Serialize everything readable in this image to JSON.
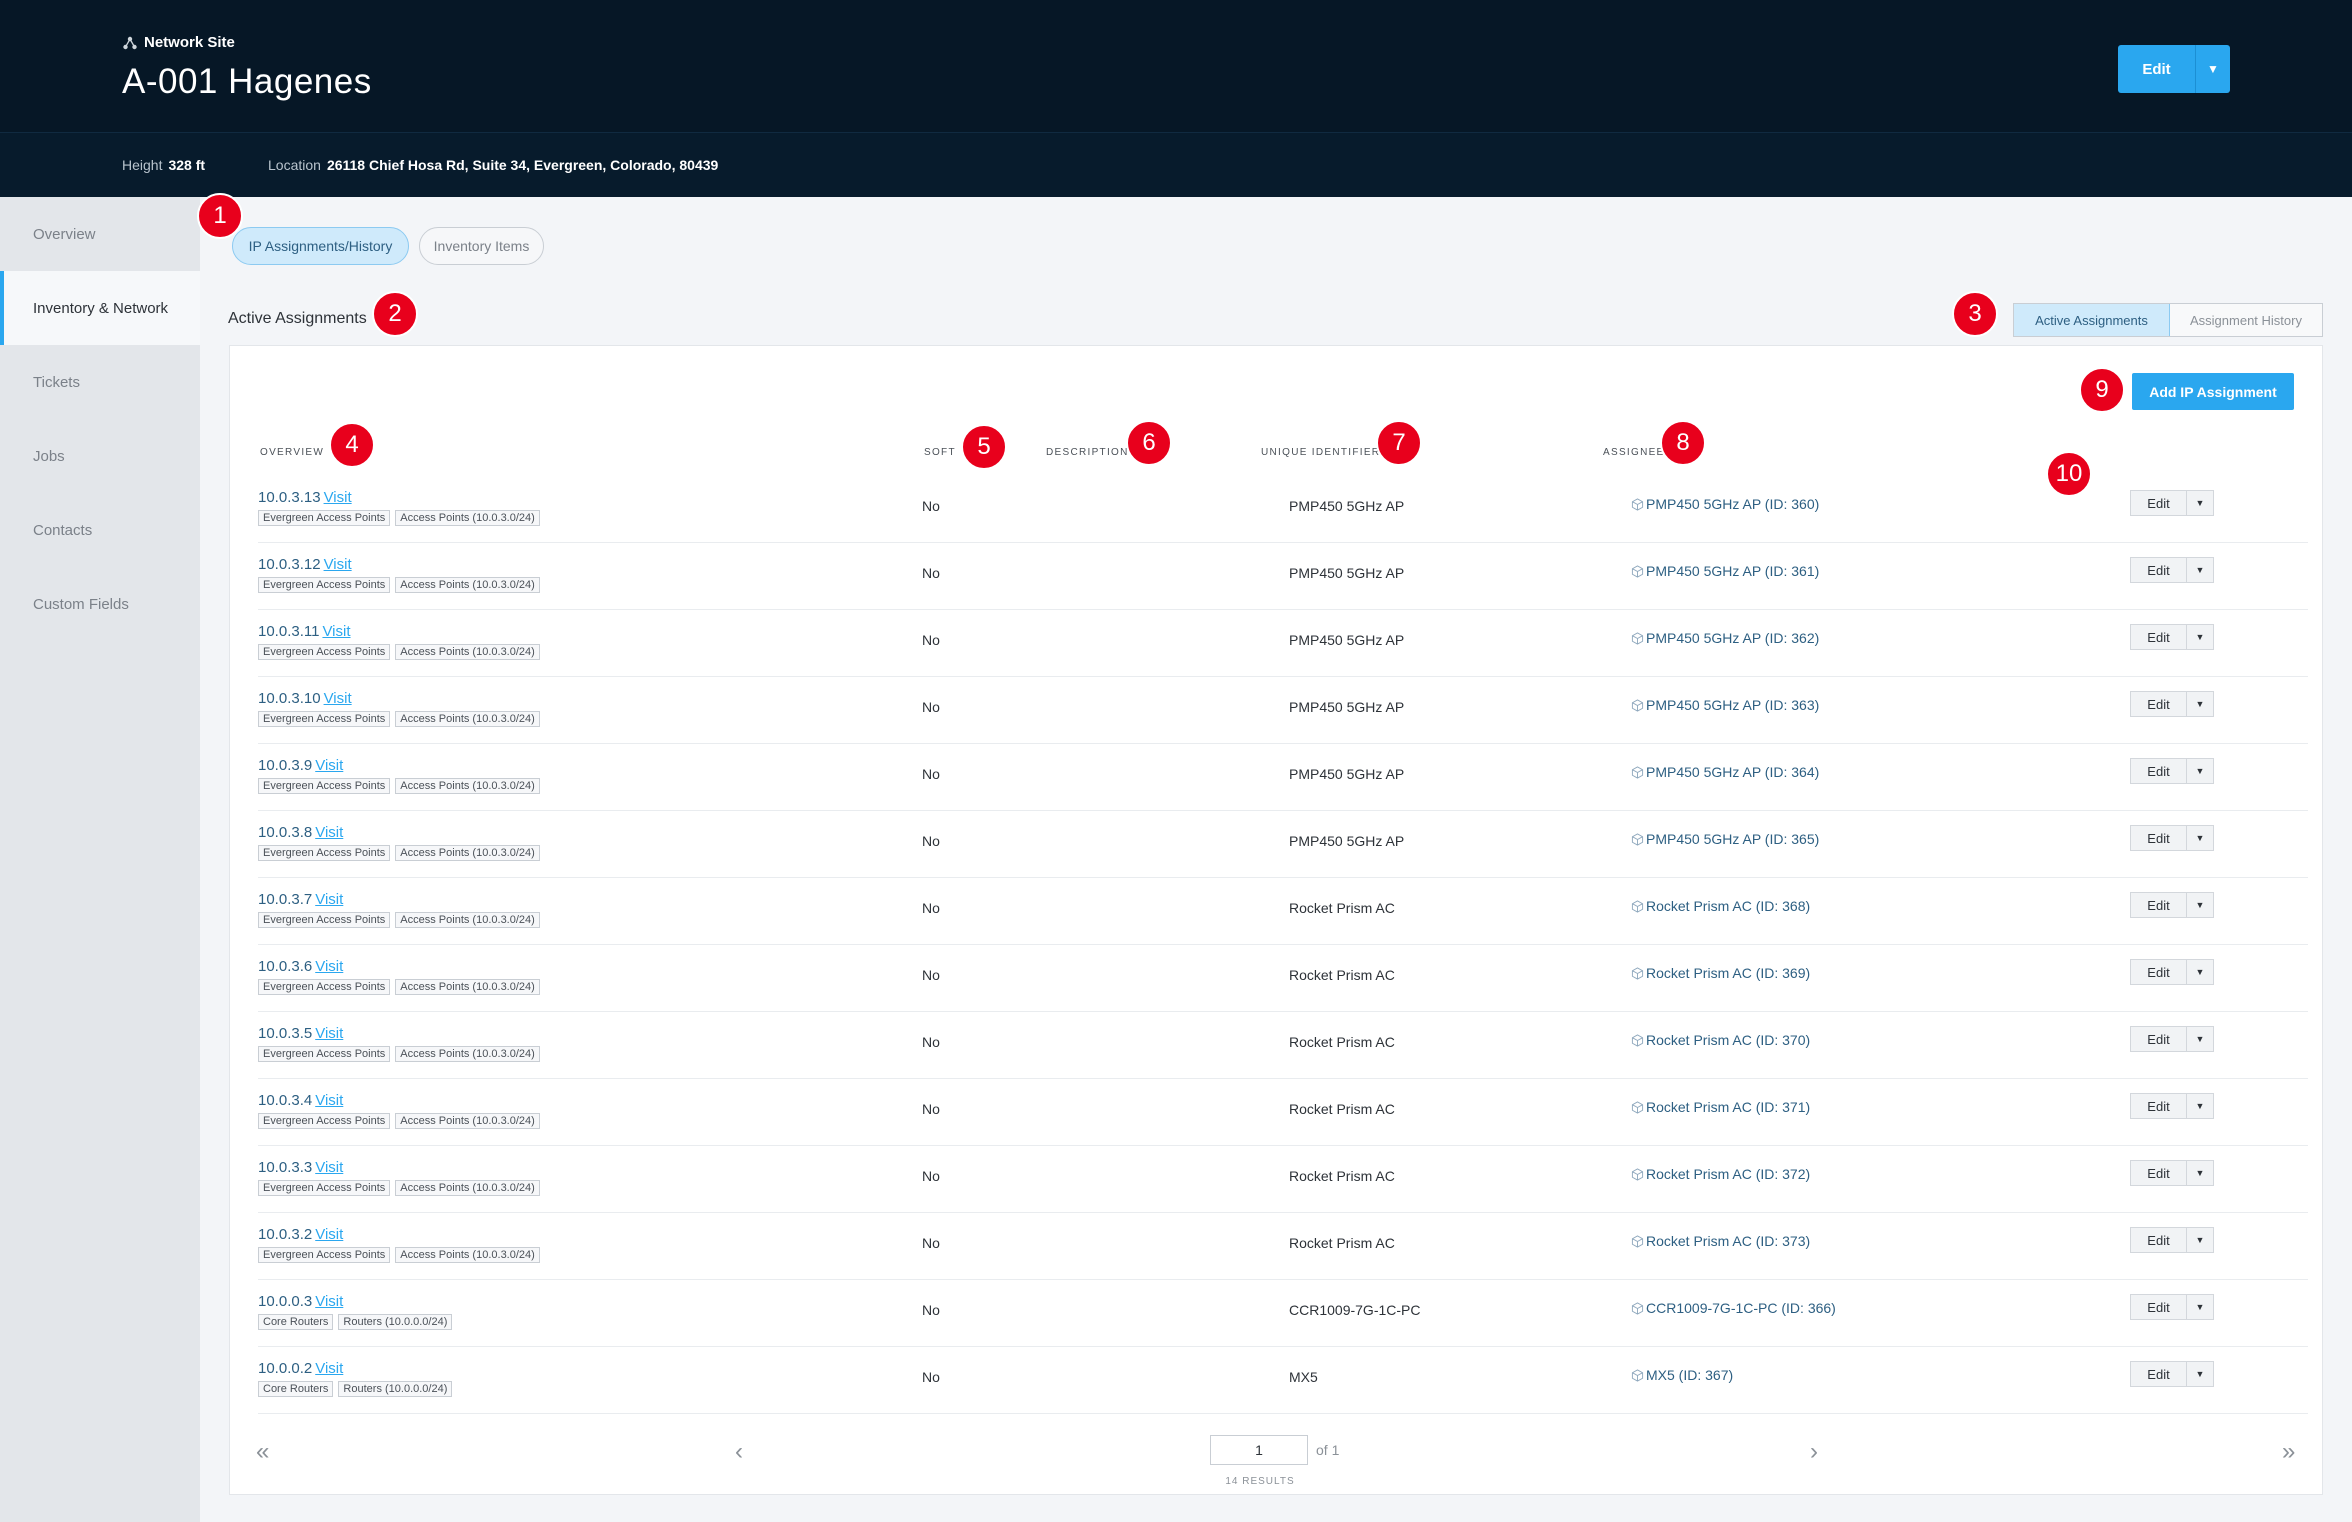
{
  "header": {
    "kicker": "Network Site",
    "title": "A-001 Hagenes",
    "edit_label": "Edit",
    "height_label": "Height",
    "height_value": "328 ft",
    "location_label": "Location",
    "location_value": "26118 Chief Hosa Rd, Suite 34, Evergreen, Colorado, 80439"
  },
  "sidebar": {
    "items": [
      {
        "label": "Overview"
      },
      {
        "label": "Inventory & Network"
      },
      {
        "label": "Tickets"
      },
      {
        "label": "Jobs"
      },
      {
        "label": "Contacts"
      },
      {
        "label": "Custom Fields"
      }
    ]
  },
  "tabs": {
    "ip": "IP Assignments/History",
    "inventory": "Inventory Items"
  },
  "section": {
    "title": "Active Assignments",
    "active_toggle": "Active Assignments",
    "history_toggle": "Assignment History",
    "add_button": "Add IP Assignment"
  },
  "columns": {
    "overview": "Overview",
    "soft": "Soft",
    "description": "Description",
    "unique_identifier": "Unique Identifier",
    "assignee": "Assignee"
  },
  "visit_label": "Visit",
  "row_edit_label": "Edit",
  "rows": [
    {
      "ip": "10.0.3.13",
      "tags": [
        "Evergreen Access Points",
        "Access Points (10.0.3.0/24)"
      ],
      "soft": "No",
      "uid": "PMP450 5GHz AP",
      "assignee": "PMP450 5GHz AP (ID: 360)"
    },
    {
      "ip": "10.0.3.12",
      "tags": [
        "Evergreen Access Points",
        "Access Points (10.0.3.0/24)"
      ],
      "soft": "No",
      "uid": "PMP450 5GHz AP",
      "assignee": "PMP450 5GHz AP (ID: 361)"
    },
    {
      "ip": "10.0.3.11",
      "tags": [
        "Evergreen Access Points",
        "Access Points (10.0.3.0/24)"
      ],
      "soft": "No",
      "uid": "PMP450 5GHz AP",
      "assignee": "PMP450 5GHz AP (ID: 362)"
    },
    {
      "ip": "10.0.3.10",
      "tags": [
        "Evergreen Access Points",
        "Access Points (10.0.3.0/24)"
      ],
      "soft": "No",
      "uid": "PMP450 5GHz AP",
      "assignee": "PMP450 5GHz AP (ID: 363)"
    },
    {
      "ip": "10.0.3.9",
      "tags": [
        "Evergreen Access Points",
        "Access Points (10.0.3.0/24)"
      ],
      "soft": "No",
      "uid": "PMP450 5GHz AP",
      "assignee": "PMP450 5GHz AP (ID: 364)"
    },
    {
      "ip": "10.0.3.8",
      "tags": [
        "Evergreen Access Points",
        "Access Points (10.0.3.0/24)"
      ],
      "soft": "No",
      "uid": "PMP450 5GHz AP",
      "assignee": "PMP450 5GHz AP (ID: 365)"
    },
    {
      "ip": "10.0.3.7",
      "tags": [
        "Evergreen Access Points",
        "Access Points (10.0.3.0/24)"
      ],
      "soft": "No",
      "uid": "Rocket Prism AC",
      "assignee": "Rocket Prism AC (ID: 368)"
    },
    {
      "ip": "10.0.3.6",
      "tags": [
        "Evergreen Access Points",
        "Access Points (10.0.3.0/24)"
      ],
      "soft": "No",
      "uid": "Rocket Prism AC",
      "assignee": "Rocket Prism AC (ID: 369)"
    },
    {
      "ip": "10.0.3.5",
      "tags": [
        "Evergreen Access Points",
        "Access Points (10.0.3.0/24)"
      ],
      "soft": "No",
      "uid": "Rocket Prism AC",
      "assignee": "Rocket Prism AC (ID: 370)"
    },
    {
      "ip": "10.0.3.4",
      "tags": [
        "Evergreen Access Points",
        "Access Points (10.0.3.0/24)"
      ],
      "soft": "No",
      "uid": "Rocket Prism AC",
      "assignee": "Rocket Prism AC (ID: 371)"
    },
    {
      "ip": "10.0.3.3",
      "tags": [
        "Evergreen Access Points",
        "Access Points (10.0.3.0/24)"
      ],
      "soft": "No",
      "uid": "Rocket Prism AC",
      "assignee": "Rocket Prism AC (ID: 372)"
    },
    {
      "ip": "10.0.3.2",
      "tags": [
        "Evergreen Access Points",
        "Access Points (10.0.3.0/24)"
      ],
      "soft": "No",
      "uid": "Rocket Prism AC",
      "assignee": "Rocket Prism AC (ID: 373)"
    },
    {
      "ip": "10.0.0.3",
      "tags": [
        "Core Routers",
        "Routers (10.0.0.0/24)"
      ],
      "soft": "No",
      "uid": "CCR1009-7G-1C-PC",
      "assignee": "CCR1009-7G-1C-PC (ID: 366)"
    },
    {
      "ip": "10.0.0.2",
      "tags": [
        "Core Routers",
        "Routers (10.0.0.0/24)"
      ],
      "soft": "No",
      "uid": "MX5",
      "assignee": "MX5 (ID: 367)"
    }
  ],
  "pagination": {
    "page": "1",
    "of_label": "of 1",
    "results": "14 RESULTS"
  },
  "annotations": [
    "1",
    "2",
    "3",
    "4",
    "5",
    "6",
    "7",
    "8",
    "9",
    "10"
  ]
}
